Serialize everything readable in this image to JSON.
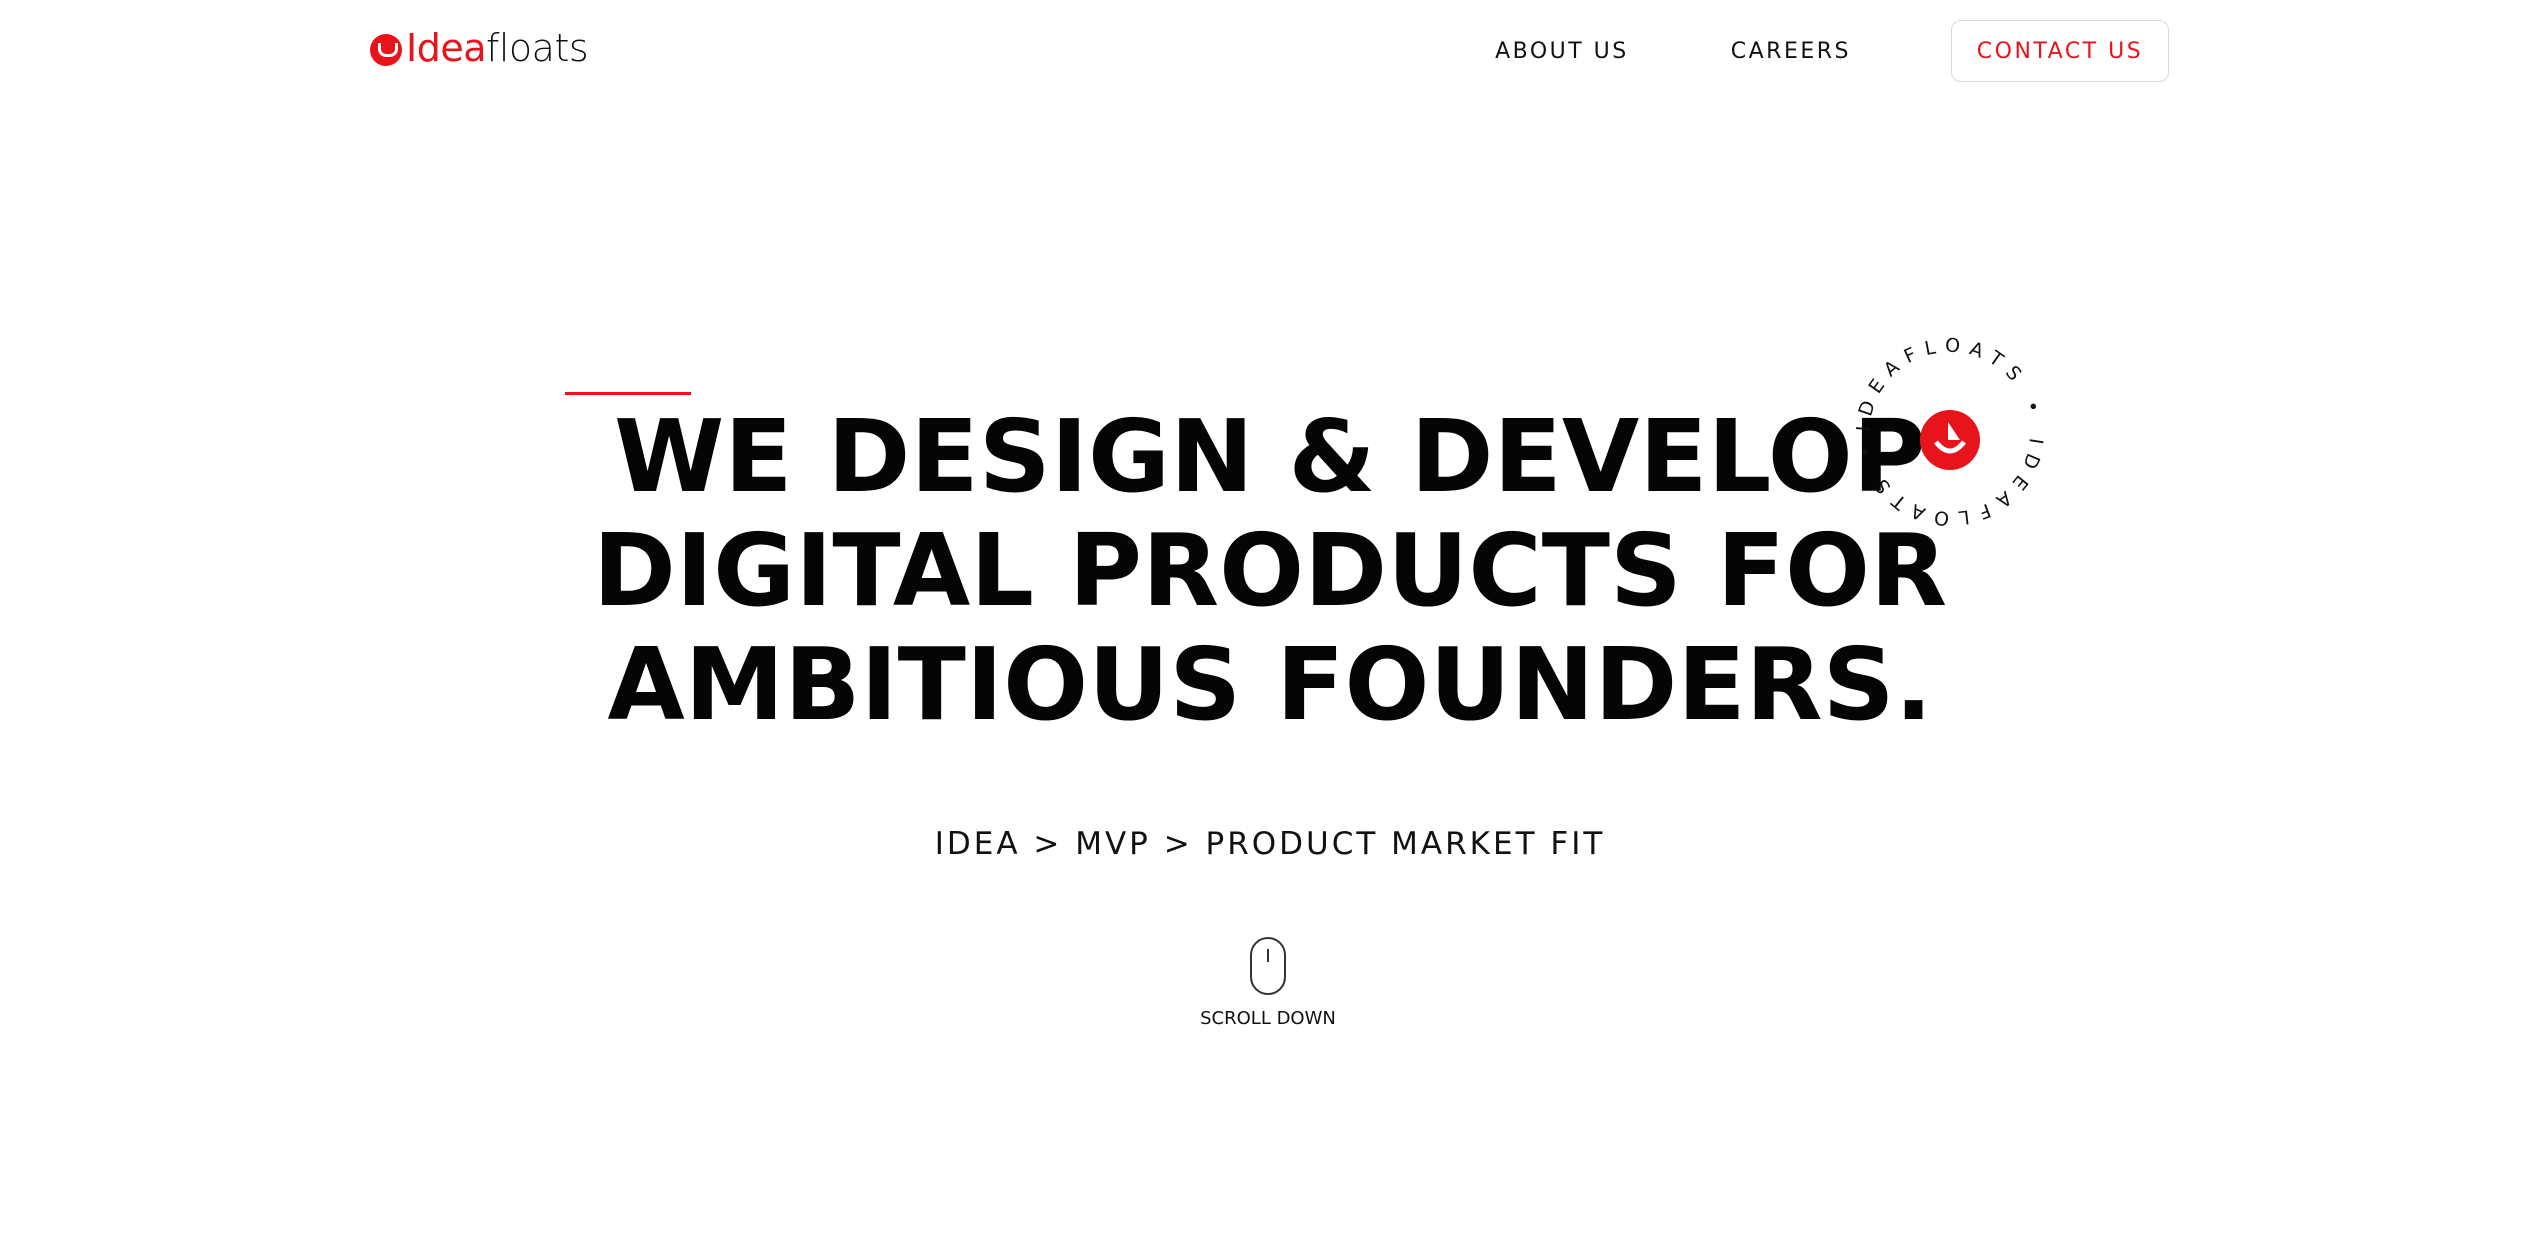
{
  "header": {
    "logo": {
      "idea": "Idea",
      "floats": "floats"
    },
    "nav": {
      "about": "ABOUT US",
      "careers": "CAREERS",
      "contact": "CONTACT US"
    }
  },
  "hero": {
    "headline": [
      "WE DESIGN & DEVELOP",
      "DIGITAL PRODUCTS FOR",
      "AMBITIOUS FOUNDERS."
    ],
    "tagline": "IDEA > MVP > PRODUCT MARKET FIT",
    "scroll_label": "SCROLL DOWN"
  },
  "badge": {
    "ring_text": "IDEAFLOATS • IDEAFLOATS •"
  },
  "colors": {
    "brand": "#e8141b",
    "text": "#0b0b0b"
  }
}
